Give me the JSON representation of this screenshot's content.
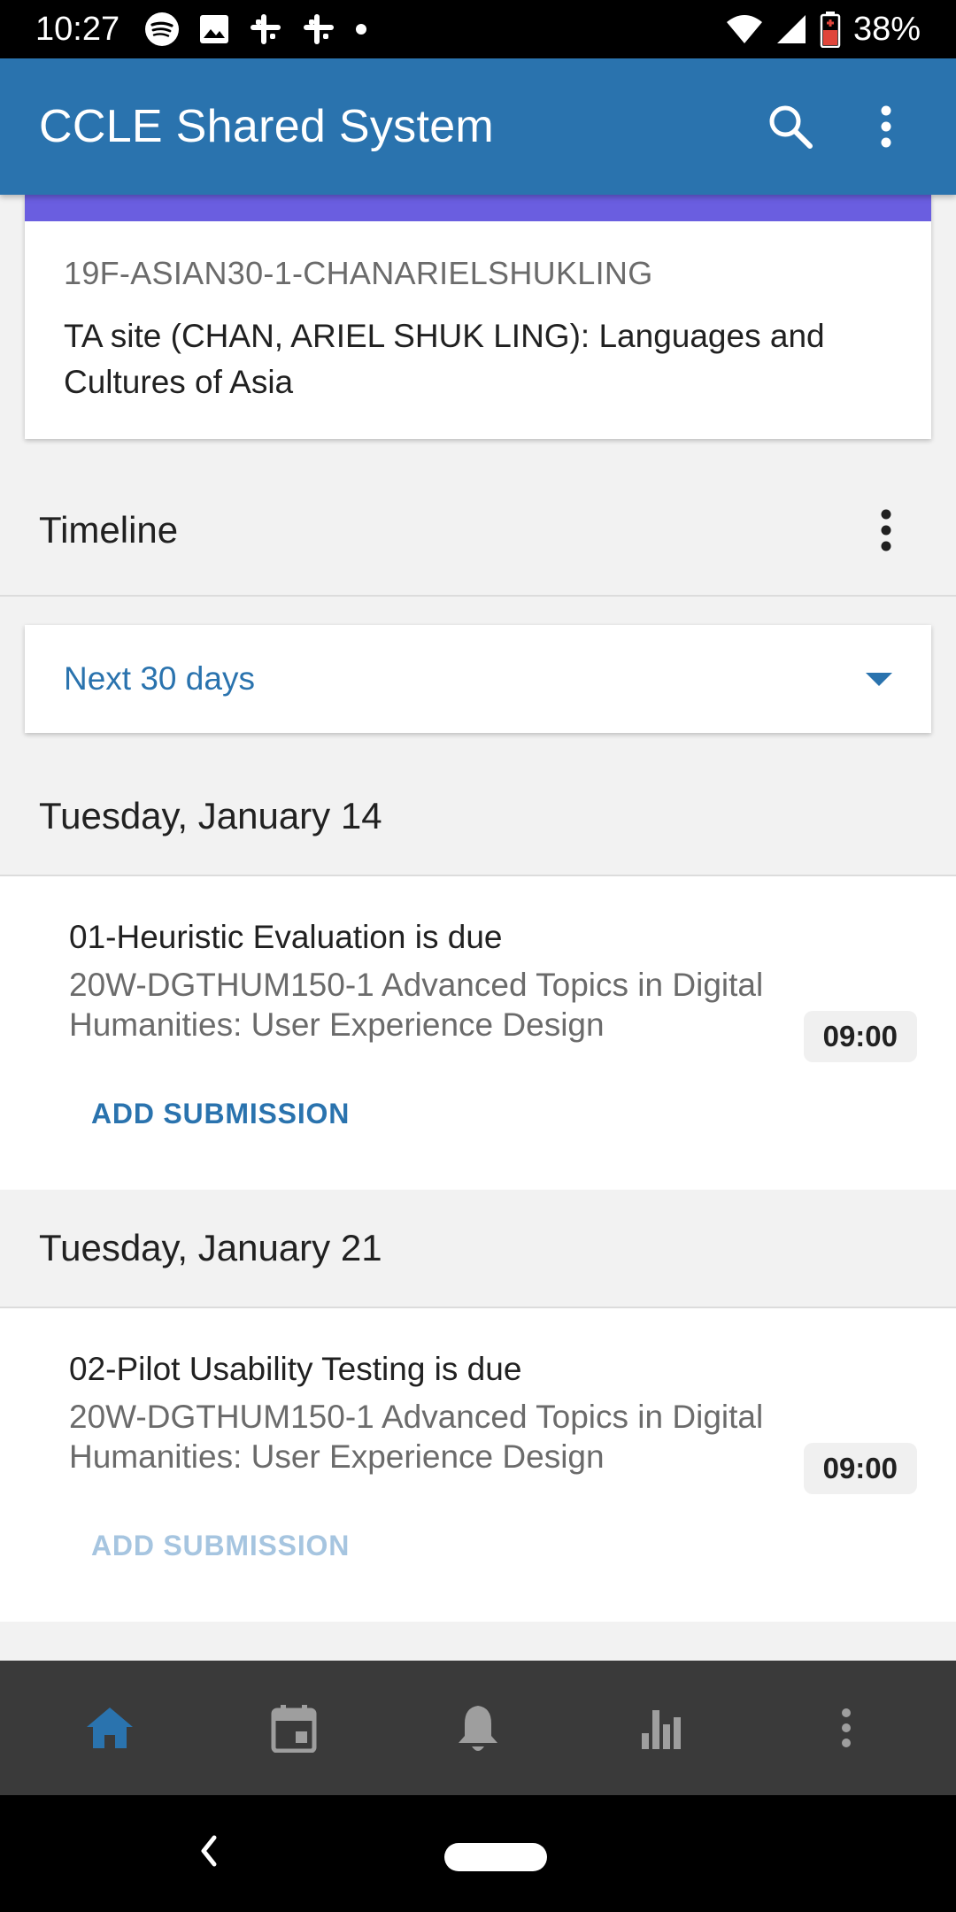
{
  "status_bar": {
    "time": "10:27",
    "battery": "38%",
    "icons": [
      "spotify-icon",
      "image-icon",
      "slack-icon",
      "slack-icon",
      "dot-icon",
      "wifi-icon",
      "cellular-signal-icon",
      "battery-low-icon"
    ]
  },
  "app_bar": {
    "title": "CCLE Shared System",
    "actions": [
      "search-icon",
      "more-vertical-icon"
    ]
  },
  "course_card": {
    "accent_color": "#6a5ee0",
    "code": "19F-ASIAN30-1-CHANARIELSHUKLING",
    "description": "TA site (CHAN, ARIEL SHUK LING): Languages and Cultures of Asia"
  },
  "timeline": {
    "title": "Timeline",
    "filter": "Next 30 days",
    "days": [
      {
        "date": "Tuesday, January 14",
        "events": [
          {
            "title": "01-Heuristic Evaluation is due",
            "course": "20W-DGTHUM150-1 Advanced Topics in Digital Humanities: User Experience Design",
            "time": "09:00",
            "action": "ADD SUBMISSION"
          }
        ]
      },
      {
        "date": "Tuesday, January 21",
        "events": [
          {
            "title": "02-Pilot Usability Testing is due",
            "course": "20W-DGTHUM150-1 Advanced Topics in Digital Humanities: User Experience Design",
            "time": "09:00",
            "action": "ADD SUBMISSION"
          }
        ]
      }
    ]
  },
  "bottom_nav": {
    "items": [
      "home-icon",
      "calendar-icon",
      "notifications-icon",
      "grades-icon",
      "more-vertical-icon"
    ],
    "active_color": "#2a73ae",
    "inactive_color": "#9e9e9e"
  },
  "colors": {
    "primary": "#2a73ae",
    "status_bar": "#000000",
    "bottom_nav": "#3a3a3a"
  }
}
